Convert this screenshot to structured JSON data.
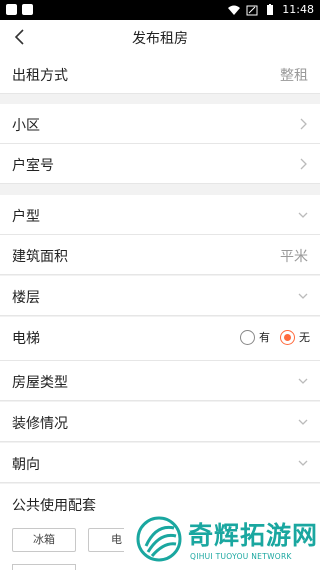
{
  "status": {
    "time": "11:48"
  },
  "header": {
    "title": "发布租房"
  },
  "rows": {
    "rent_mode": {
      "label": "出租方式",
      "value": "整租"
    },
    "community": {
      "label": "小区"
    },
    "room_no": {
      "label": "户室号"
    },
    "layout": {
      "label": "户型"
    },
    "area": {
      "label": "建筑面积",
      "value": "平米"
    },
    "floor": {
      "label": "楼层"
    },
    "elevator": {
      "label": "电梯",
      "options": [
        "有",
        "无"
      ],
      "selected": "无"
    },
    "house_type": {
      "label": "房屋类型"
    },
    "decoration": {
      "label": "装修情况"
    },
    "orientation": {
      "label": "朝向"
    },
    "facilities": {
      "label": "公共使用配套",
      "chips": [
        "冰箱",
        "电"
      ]
    }
  },
  "watermark": {
    "name": "奇辉拓游网",
    "sub": "QIHUI TUOYOU NETWORK"
  },
  "colors": {
    "accent": "#ff6a3d",
    "chevron": "#bbbbbb",
    "watermark": "#1aa7a0"
  }
}
